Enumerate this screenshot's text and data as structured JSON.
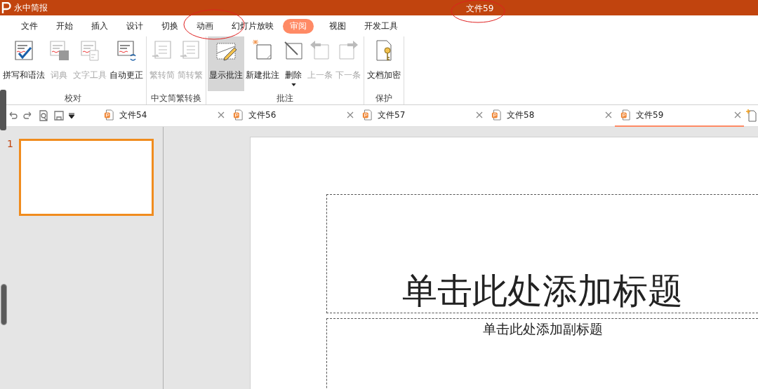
{
  "app": {
    "name": "永中简报",
    "document_title": "文件59"
  },
  "menu_tabs": [
    {
      "label": "文件",
      "selected": false
    },
    {
      "label": "开始",
      "selected": false
    },
    {
      "label": "插入",
      "selected": false
    },
    {
      "label": "设计",
      "selected": false
    },
    {
      "label": "切换",
      "selected": false
    },
    {
      "label": "动画",
      "selected": false
    },
    {
      "label": "幻灯片放映",
      "selected": false
    },
    {
      "label": "审阅",
      "selected": true
    },
    {
      "label": "视图",
      "selected": false
    },
    {
      "label": "开发工具",
      "selected": false
    }
  ],
  "ribbon_groups": [
    {
      "label": "校对",
      "buttons": [
        {
          "label": "拼写和语法",
          "kind": "spell",
          "disabled": false,
          "selected": false
        },
        {
          "label": "词典",
          "kind": "dictionary",
          "disabled": true,
          "selected": false
        },
        {
          "label": "文字工具",
          "kind": "texttool",
          "disabled": true,
          "selected": false
        },
        {
          "label": "自动更正",
          "kind": "autocorrect",
          "disabled": false,
          "selected": false
        }
      ]
    },
    {
      "label": "中文简繁转换",
      "buttons": [
        {
          "label": "繁转简",
          "kind": "convert",
          "disabled": true,
          "selected": false
        },
        {
          "label": "简转繁",
          "kind": "convert",
          "disabled": true,
          "selected": false
        }
      ]
    },
    {
      "label": "批注",
      "buttons": [
        {
          "label": "显示批注",
          "kind": "showcomment",
          "disabled": false,
          "selected": true
        },
        {
          "label": "新建批注",
          "kind": "newcomment",
          "disabled": false,
          "selected": false
        },
        {
          "label": "删除",
          "kind": "deletecomment",
          "disabled": false,
          "selected": false,
          "dropdown": true
        },
        {
          "label": "上一条",
          "kind": "prev",
          "disabled": true,
          "selected": false
        },
        {
          "label": "下一条",
          "kind": "next",
          "disabled": true,
          "selected": false
        }
      ]
    },
    {
      "label": "保护",
      "buttons": [
        {
          "label": "文档加密",
          "kind": "encrypt",
          "disabled": false,
          "selected": false
        }
      ]
    }
  ],
  "doc_tabs": [
    {
      "label": "文件54",
      "selected": false
    },
    {
      "label": "文件56",
      "selected": false
    },
    {
      "label": "文件57",
      "selected": false
    },
    {
      "label": "文件58",
      "selected": false
    },
    {
      "label": "文件59",
      "selected": true
    }
  ],
  "slides": [
    {
      "number": "1",
      "selected": true
    }
  ],
  "slide": {
    "title_placeholder": "单击此处添加标题",
    "subtitle_placeholder": "单击此处添加副标题"
  }
}
